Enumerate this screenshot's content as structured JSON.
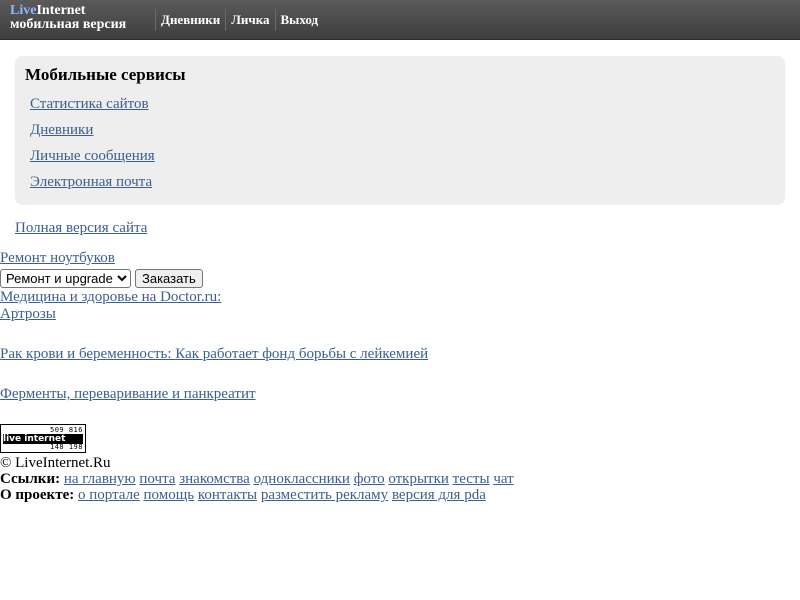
{
  "header": {
    "logo_live": "Live",
    "logo_internet": "Internet",
    "logo_sub": "мобильная версия",
    "nav": [
      "Дневники",
      "Личка",
      "Выход"
    ]
  },
  "services": {
    "title": "Мобильные сервисы",
    "items": [
      "Статистика сайтов",
      "Дневники",
      "Личные сообщения",
      "Электронная почта"
    ]
  },
  "full_version": "Полная версия сайта",
  "ad": {
    "repair_link": "Ремонт ноутбуков",
    "select_value": "Ремонт и upgrade",
    "order_button": "Заказать",
    "doctor_link": "Медицина и здоровье на Doctor.ru:",
    "arthrosis_link": "Артрозы",
    "article1": "Рак крови и беременность: Как работает фонд борьбы с лейкемией",
    "article2": "Ферменты, переваривание и панкреатит"
  },
  "counter": {
    "top": "509 816",
    "mid": "live internet",
    "bottom": "148 198"
  },
  "footer": {
    "copyright": "© LiveInternet.Ru",
    "links_label": "Ссылки:",
    "links": [
      "на главную",
      "почта",
      "знакомства",
      "одноклассники",
      "фото",
      "открытки",
      "тесты",
      "чат"
    ],
    "about_label": "О проекте:",
    "about": [
      "о портале",
      "помощь",
      "контакты",
      "разместить рекламу",
      "версия для pda"
    ]
  },
  "colors": {
    "link": "#3b5f8f",
    "header_bg": "#4a4a4a",
    "panel_bg": "#eeeeee"
  }
}
